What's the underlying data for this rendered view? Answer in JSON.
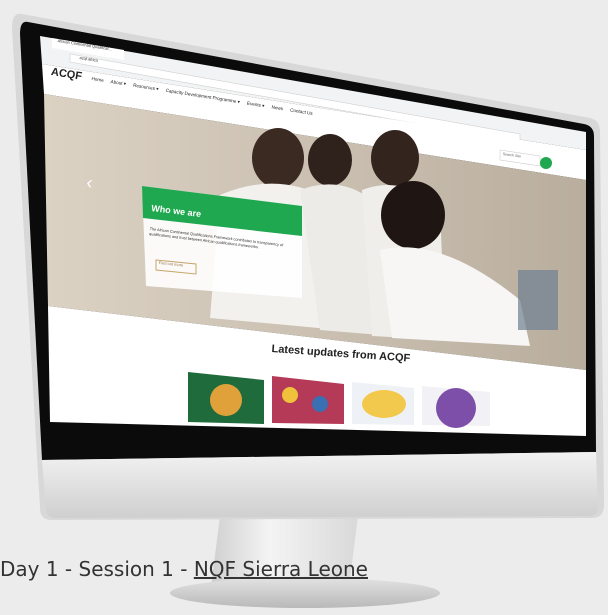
{
  "browser": {
    "tab_title": "African Continental Qualificat...",
    "url": "acqf.africa",
    "search_placeholder": "Search Site"
  },
  "site": {
    "logo": "ACQF",
    "nav": [
      "Home",
      "About ▾",
      "Resources ▾",
      "Capacity Development Programme ▾",
      "Events ▾",
      "News",
      "Contact Us"
    ]
  },
  "hero": {
    "card_title": "Who we are",
    "card_text": "The African Continental Qualifications Framework contributes to transparency of qualifications and trust between African qualifications frameworks.",
    "card_button": "Find out more",
    "prev_arrow": "‹"
  },
  "updates": {
    "heading": "Latest updates from ACQF"
  },
  "caption": {
    "prefix": "Day 1 - Session 1 - ",
    "link": "NQF Sierra Leone"
  },
  "colors": {
    "accent": "#1fa84f",
    "bezel": "#0b0b0b",
    "frame": "#d9d9d9"
  }
}
